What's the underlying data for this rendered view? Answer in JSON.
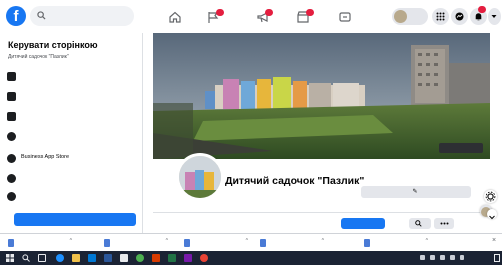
{
  "topbar": {
    "logo_letter": "f",
    "search_placeholder": "",
    "nav_icons": [
      "home-icon",
      "flag-icon",
      "megaphone-icon",
      "storefront-icon",
      "gaming-icon"
    ],
    "account_name": "",
    "actions": [
      "grid-menu-icon",
      "messenger-icon",
      "bell-icon",
      "account-caret-icon"
    ]
  },
  "sidebar": {
    "title": "Керувати сторінкою",
    "page_subtitle": "Дитячий садочок \"Пазлик\"",
    "items": [
      {
        "icon": "house-icon",
        "label": "",
        "note": ""
      },
      {
        "icon": "news-icon",
        "label": "",
        "note": ""
      },
      {
        "icon": "bell-icon",
        "label": "",
        "note": ""
      },
      {
        "icon": "chat-icon",
        "label": "",
        "note": ""
      },
      {
        "icon": "business-icon",
        "label": "Business App Store",
        "note": ""
      },
      {
        "icon": "resources-icon",
        "label": "",
        "note": ""
      },
      {
        "icon": "lightning-icon",
        "label": "",
        "note": ""
      }
    ],
    "promote_label": ""
  },
  "main": {
    "edit_cover_label": "",
    "page_name": "Дитячий садочок \"Пазлик\"",
    "page_subtitle": "",
    "edit_info_label": "",
    "tabs": [
      "",
      "",
      "",
      ""
    ],
    "promote_label": ""
  },
  "downloads": {
    "items": [
      "",
      "",
      "",
      "",
      ""
    ],
    "show_all": ""
  },
  "colors": {
    "facebook_blue": "#1877f2",
    "notification_red": "#e41e3f",
    "page_bg": "#f0f2f5",
    "taskbar": "#1b2334"
  }
}
